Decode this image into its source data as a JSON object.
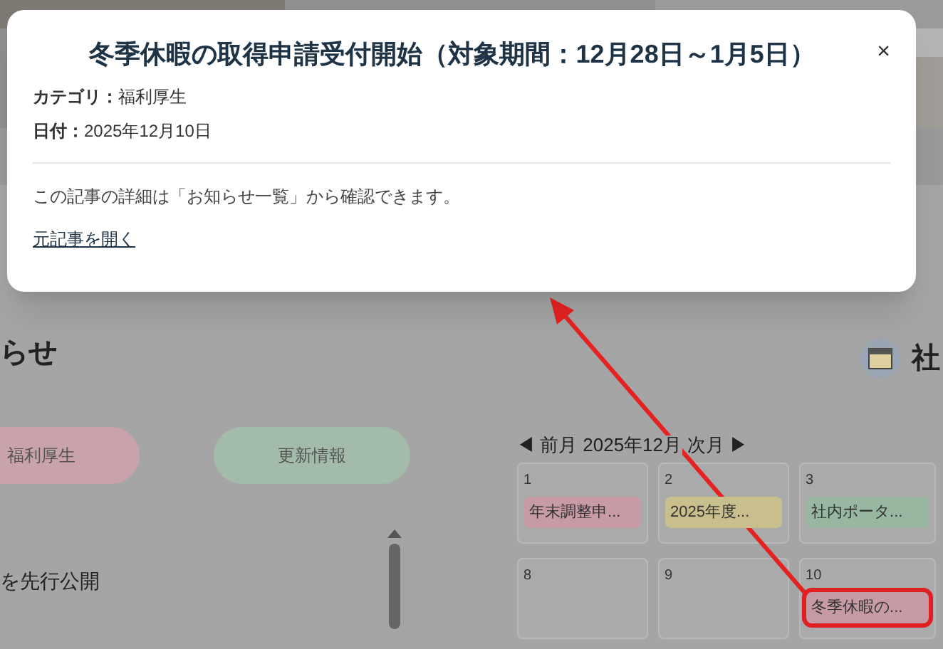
{
  "modal": {
    "title": "冬季休暇の取得申請受付開始（対象期間：12月28日～1月5日）",
    "close": "×",
    "fields": [
      {
        "label": "カテゴリ：",
        "value": "福利厚生"
      },
      {
        "label": "日付：",
        "value": "2025年12月10日"
      }
    ],
    "note": "この記事の詳細は「お知らせ一覧」から確認できます。",
    "link": "元記事を開く"
  },
  "page": {
    "news_heading": "らせ",
    "calendar_heading": "社",
    "filters": [
      {
        "label": "福利厚生",
        "color": "#c9a3ab"
      },
      {
        "label": "更新情報",
        "color": "#a2bca9"
      }
    ],
    "list_item": "を先行公開",
    "calendar": {
      "prev": "◀ 前月",
      "month": "2025年12月",
      "next": "次月 ▶",
      "days": [
        {
          "day": "1",
          "events": [
            {
              "title": "年末調整申...",
              "color": "#c79ba6",
              "highlighted": false
            }
          ]
        },
        {
          "day": "2",
          "events": [
            {
              "title": "2025年度...",
              "color": "#c9bf8c",
              "highlighted": false
            }
          ]
        },
        {
          "day": "3",
          "events": [
            {
              "title": "社内ポータ...",
              "color": "#97b7a1",
              "highlighted": false
            }
          ]
        },
        {
          "day": "8"
        },
        {
          "day": "9"
        },
        {
          "day": "10",
          "events": [
            {
              "title": "冬季休暇の...",
              "color": "#c79ba6",
              "highlighted": true
            }
          ]
        }
      ]
    }
  }
}
